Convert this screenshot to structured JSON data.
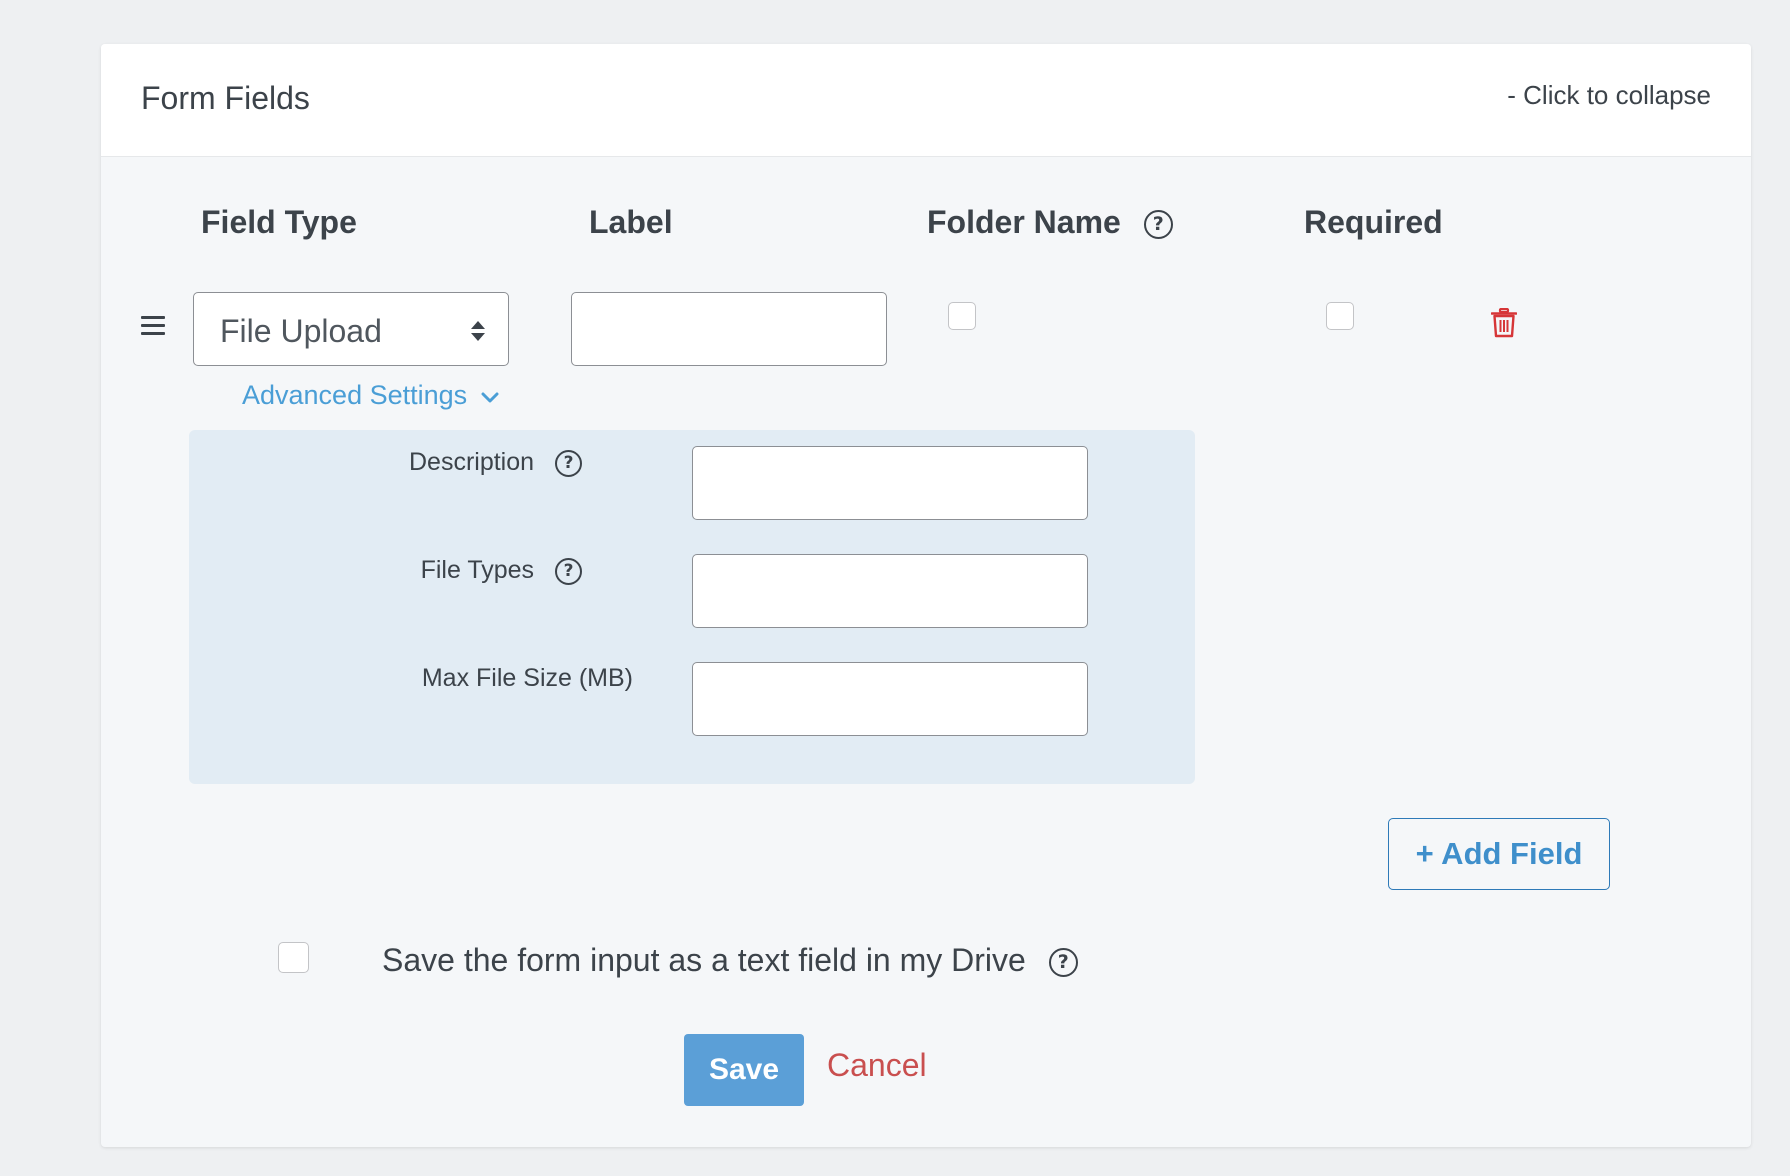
{
  "panel": {
    "title": "Form Fields",
    "collapse_label": "- Click to collapse"
  },
  "columns": {
    "field_type": "Field Type",
    "label": "Label",
    "folder_name": "Folder Name",
    "required": "Required"
  },
  "field_row": {
    "field_type_value": "File Upload",
    "label_value": "",
    "folder_name_checked": false,
    "required_checked": false,
    "advanced_settings_label": "Advanced Settings"
  },
  "advanced": {
    "description_label": "Description",
    "description_value": "",
    "file_types_label": "File Types",
    "file_types_value": "",
    "max_file_size_label": "Max File Size (MB)",
    "max_file_size_value": ""
  },
  "add_field_label": "+ Add Field",
  "save_as_text": {
    "label": "Save the form input as a text field in my Drive",
    "checked": false
  },
  "actions": {
    "save_label": "Save",
    "cancel_label": "Cancel"
  },
  "icons": {
    "help": "question-circle-icon",
    "drag": "drag-handle-icon",
    "delete": "trash-icon",
    "chevron": "chevron-down-icon"
  },
  "colors": {
    "link": "#4a9ed6",
    "primary_button": "#5b9fd7",
    "cancel": "#c94f4f",
    "delete": "#d63638",
    "advanced_bg": "#e2ecf4"
  }
}
